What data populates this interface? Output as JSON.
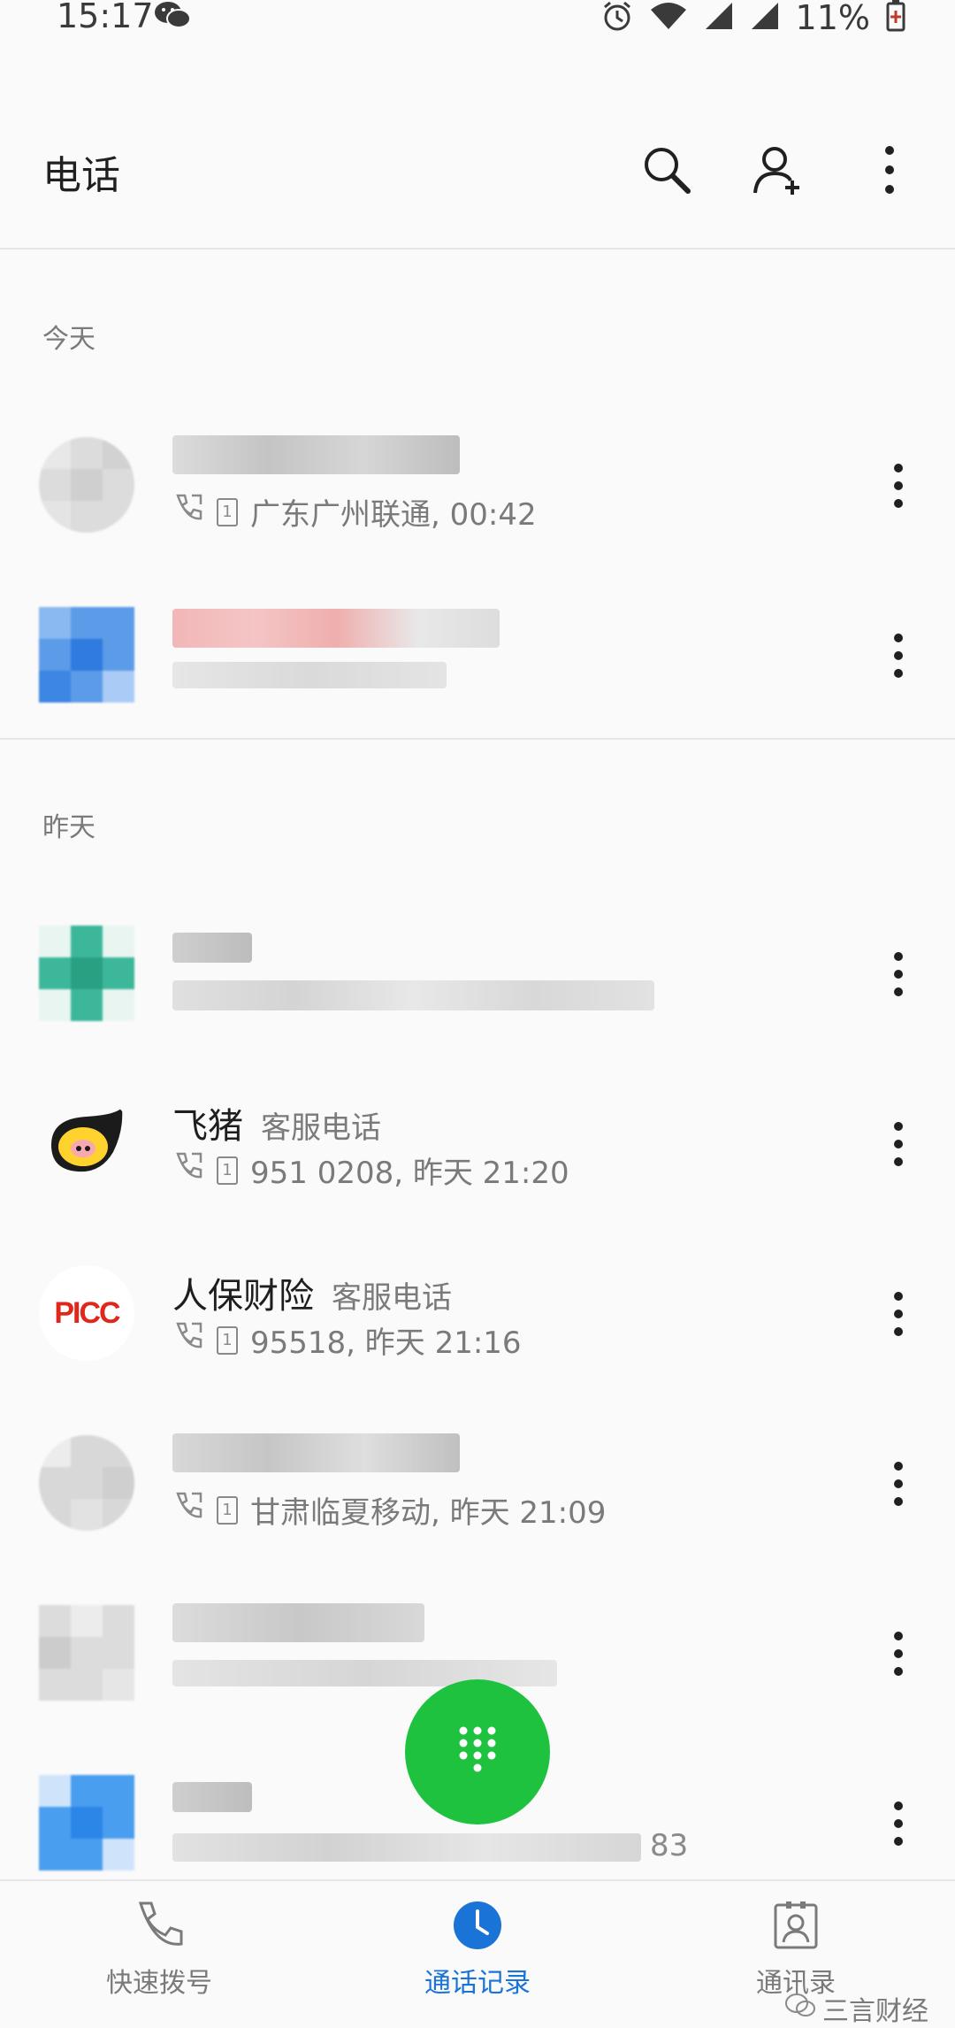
{
  "status_bar": {
    "time": "15:17",
    "battery_pct": "11%"
  },
  "app_bar": {
    "title": "电话"
  },
  "sections": [
    {
      "label": "今天"
    },
    {
      "label": "昨天"
    }
  ],
  "calls": [
    {
      "name": "",
      "tag": "",
      "detail": "广东广州联通, 00:42"
    },
    {
      "name": "",
      "tag": "",
      "detail": ""
    },
    {
      "name": "",
      "tag": "",
      "detail": ""
    },
    {
      "name": "飞猪",
      "tag": "客服电话",
      "detail": "951 0208, 昨天 21:20"
    },
    {
      "name": "人保财险",
      "tag": "客服电话",
      "detail": "95518, 昨天 21:16",
      "avatar_text": "PICC"
    },
    {
      "name": "",
      "tag": "",
      "detail": "甘肃临夏移动, 昨天 21:09"
    },
    {
      "name": "",
      "tag": "",
      "detail": ""
    },
    {
      "name": "",
      "tag": "",
      "detail": "83"
    }
  ],
  "bottom_nav": {
    "items": [
      {
        "label": "快速拨号"
      },
      {
        "label": "通话记录"
      },
      {
        "label": "通讯录"
      }
    ]
  },
  "watermark": "三言财经",
  "colors": {
    "accent": "#1a73d6",
    "fab": "#1fc23f"
  }
}
